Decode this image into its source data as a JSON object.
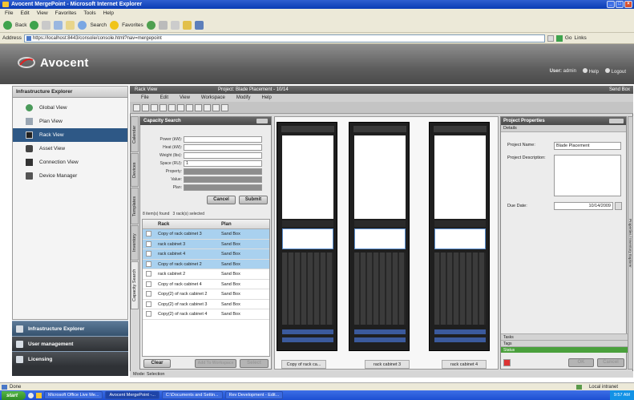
{
  "window": {
    "title": "Avocent MergePoint - Microsoft Internet Explorer"
  },
  "browser": {
    "menu": [
      "File",
      "Edit",
      "View",
      "Favorites",
      "Tools",
      "Help"
    ],
    "toolbar": {
      "back": "Back",
      "search": "Search",
      "favorites": "Favorites"
    },
    "address_label": "Address",
    "address_value": "https://localhost:8443/console/console.html?nav=mergepoint",
    "go_label": "Go",
    "links_label": "Links"
  },
  "app": {
    "logo_text": "Avocent",
    "user_label": "User:",
    "user_name": "admin",
    "help_label": "Help",
    "logout_label": "Logout"
  },
  "explorer": {
    "title": "Infrastructure Explorer",
    "items": [
      {
        "label": "Global View",
        "icon": "globe-icon"
      },
      {
        "label": "Plan View",
        "icon": "plan-icon"
      },
      {
        "label": "Rack View",
        "icon": "rack-icon",
        "selected": true
      },
      {
        "label": "Asset View",
        "icon": "asset-icon"
      },
      {
        "label": "Connection View",
        "icon": "connection-icon"
      },
      {
        "label": "Device Manager",
        "icon": "device-manager-icon"
      }
    ],
    "accordions": [
      "Infrastructure Explorer",
      "User management",
      "Licensing"
    ]
  },
  "rack_view": {
    "title": "Rack View",
    "project": "Project: Blade Placement - 10/14",
    "send_box": "Send Box",
    "menu": [
      "File",
      "Edit",
      "View",
      "Workspace",
      "Modify",
      "Help"
    ],
    "side_tabs": [
      "Capacity Search",
      "Inventory",
      "Templates",
      "Devices",
      "Calendar"
    ],
    "mode": "Mode: Selection"
  },
  "capacity_search": {
    "title": "Capacity Search",
    "fields": [
      {
        "label": "Power (kW):",
        "value": ""
      },
      {
        "label": "Heat (kW):",
        "value": ""
      },
      {
        "label": "Weight (lbs):",
        "value": ""
      },
      {
        "label": "Space (RU):",
        "value": "1"
      },
      {
        "label": "Property:",
        "value": ""
      },
      {
        "label": "Value:",
        "value": ""
      },
      {
        "label": "Plan:",
        "value": ""
      }
    ],
    "cancel_label": "Cancel",
    "submit_label": "Submit",
    "results_found": "8 item(s) found",
    "results_selected": "3 rack(s) selected",
    "columns": [
      "Rack",
      "Plan"
    ],
    "rows": [
      {
        "rack": "Copy of rack cabinet 3",
        "plan": "Sand Box",
        "selected": true
      },
      {
        "rack": "rack cabinet 3",
        "plan": "Sand Box",
        "selected": true
      },
      {
        "rack": "rack cabinet 4",
        "plan": "Sand Box",
        "selected": true
      },
      {
        "rack": "Copy of rack cabinet 2",
        "plan": "Sand Box",
        "selected": true
      },
      {
        "rack": "rack cabinet 2",
        "plan": "Sand Box",
        "selected": false
      },
      {
        "rack": "Copy of rack cabinet 4",
        "plan": "Sand Box",
        "selected": false
      },
      {
        "rack": "Copy(2) of rack cabinet 2",
        "plan": "Sand Box",
        "selected": false
      },
      {
        "rack": "Copy(2) of rack cabinet 3",
        "plan": "Sand Box",
        "selected": false
      },
      {
        "rack": "Copy(2) of rack cabinet 4",
        "plan": "Sand Box",
        "selected": false
      }
    ],
    "clear_label": "Clear",
    "add_to_workspace_label": "Add To Workspace",
    "select_label": "Select"
  },
  "racks": [
    "Copy of rack ca...",
    "rack cabinet 3",
    "rack cabinet 4"
  ],
  "project_properties": {
    "title": "Project Properties",
    "section": "Details",
    "name_label": "Project Name:",
    "name_value": "Blade Placement",
    "desc_label": "Project Description:",
    "desc_value": "",
    "due_label": "Due Date:",
    "due_value": "10/14/2009",
    "footer": [
      "Tasks",
      "Tags",
      "Status"
    ],
    "ok_label": "OK",
    "cancel_label": "Cancel",
    "right_tab": "Properties / Inventory Explorer"
  },
  "statusbar": {
    "left": "Done",
    "zone": "Local intranet"
  },
  "taskbar": {
    "start": "start",
    "tasks": [
      "Microsoft Office Live Me...",
      "Avocent MergePoint -...",
      "C:\\Documents and Settin...",
      "Rev Development - Edit..."
    ],
    "clock": "9:57 AM"
  }
}
